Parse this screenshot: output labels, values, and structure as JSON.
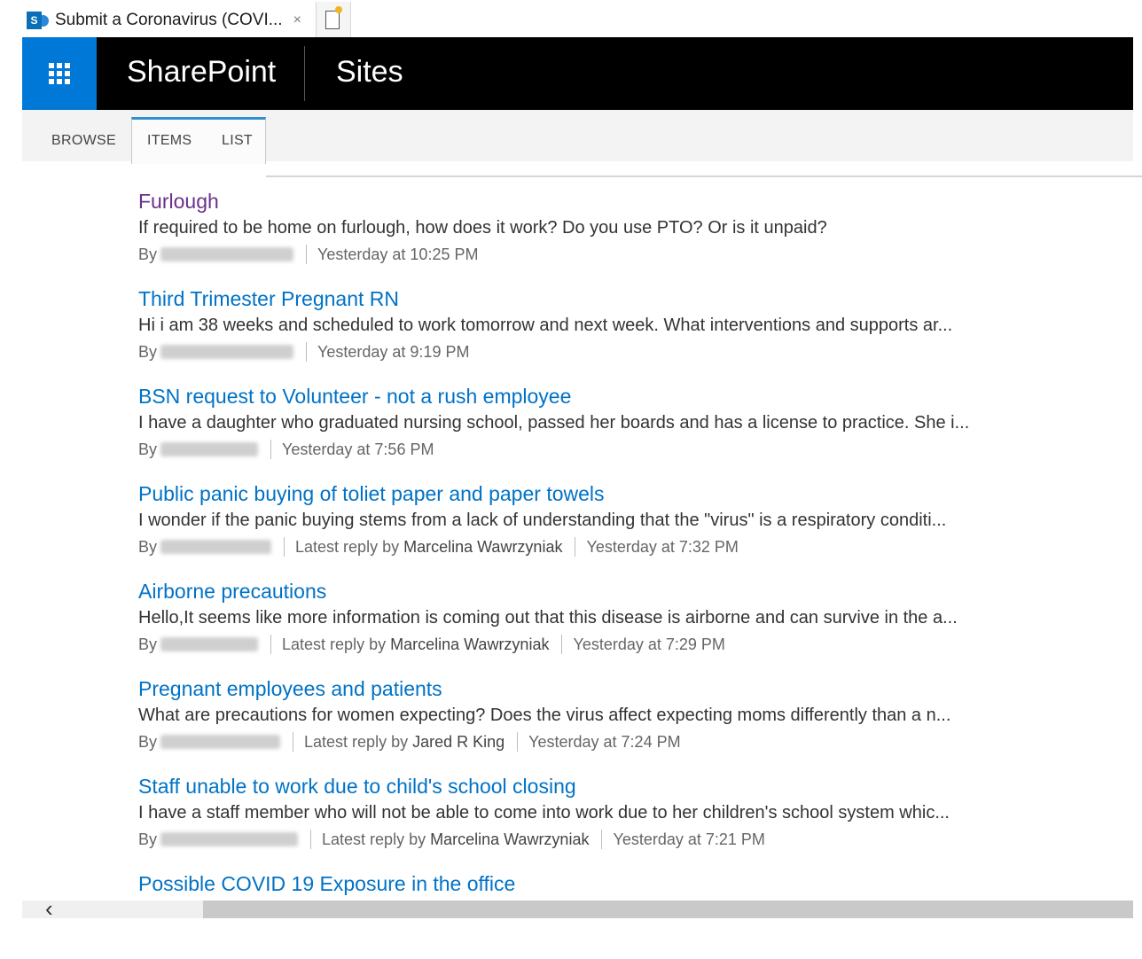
{
  "browser": {
    "tab_title": "Submit a Coronavirus (COVI...",
    "tab_close": "×"
  },
  "suite": {
    "brand": "SharePoint",
    "sites_label": "Sites"
  },
  "ribbon": {
    "tabs": [
      "BROWSE",
      "ITEMS",
      "LIST"
    ]
  },
  "discussions": [
    {
      "title": "Furlough",
      "visited": true,
      "body": "If required to be home on furlough, how does it work? Do you use PTO? Or is it unpaid?",
      "by_label": "By",
      "latest_reply_label": "",
      "latest_reply_by": "",
      "time": "Yesterday at 10:25 PM"
    },
    {
      "title": "Third Trimester Pregnant RN",
      "visited": false,
      "body": "Hi i am 38 weeks and scheduled to work tomorrow and next week. What interventions and supports ar...",
      "by_label": "By",
      "latest_reply_label": "",
      "latest_reply_by": "",
      "time": "Yesterday at 9:19 PM"
    },
    {
      "title": "BSN request to Volunteer - not a rush employee",
      "visited": false,
      "body": "I have a daughter who graduated nursing school, passed her boards and has a license to practice. She i...",
      "by_label": "By",
      "latest_reply_label": "",
      "latest_reply_by": "",
      "time": "Yesterday at 7:56 PM"
    },
    {
      "title": "Public panic buying of toliet paper and paper towels",
      "visited": false,
      "body": "I wonder if the panic buying stems from a lack of understanding that the \"virus\" is a respiratory conditi...",
      "by_label": "By",
      "latest_reply_label": "Latest reply by",
      "latest_reply_by": "Marcelina Wawrzyniak",
      "time": "Yesterday at 7:32 PM"
    },
    {
      "title": "Airborne precautions",
      "visited": false,
      "body": "Hello,It seems like more information is coming out that this disease is airborne and can survive in the a...",
      "by_label": "By",
      "latest_reply_label": "Latest reply by",
      "latest_reply_by": "Marcelina Wawrzyniak",
      "time": "Yesterday at 7:29 PM"
    },
    {
      "title": "Pregnant employees and patients",
      "visited": false,
      "body": "What are precautions for women expecting? Does the virus affect expecting moms differently than a n...",
      "by_label": "By",
      "latest_reply_label": "Latest reply by",
      "latest_reply_by": "Jared R King",
      "time": "Yesterday at 7:24 PM"
    },
    {
      "title": "Staff unable to work due to child's school closing",
      "visited": false,
      "body": " I have a staff member who will not be able to come into work due to her children's school system whic...",
      "by_label": "By",
      "latest_reply_label": "Latest reply by",
      "latest_reply_by": "Marcelina Wawrzyniak",
      "time": "Yesterday at 7:21 PM"
    },
    {
      "title": "Possible COVID 19 Exposure in the office",
      "visited": false,
      "body": "",
      "by_label": "",
      "latest_reply_label": "",
      "latest_reply_by": "",
      "time": ""
    }
  ],
  "scrollbar": {
    "left_arrow": "‹"
  },
  "colors": {
    "link": "#0072c6",
    "visited_link": "#6b2f8c",
    "suite_bar": "#000000",
    "waffle": "#0078d7",
    "ribbon_accent": "#2e8fd1"
  }
}
